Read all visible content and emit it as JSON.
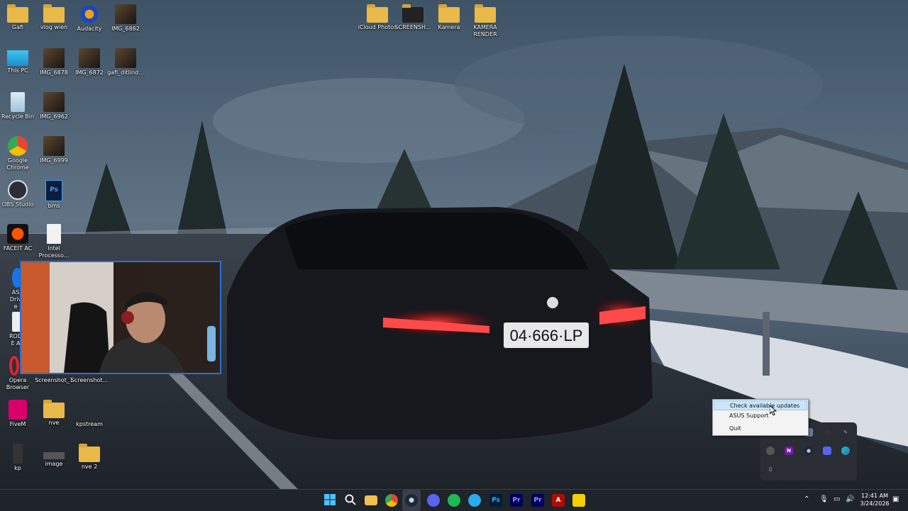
{
  "desktop": {
    "icons": [
      {
        "id": "gafi",
        "label": "Gafi",
        "type": "folder"
      },
      {
        "id": "vlog",
        "label": "vlog wien",
        "type": "folder"
      },
      {
        "id": "audacity",
        "label": "Audacity",
        "type": "app"
      },
      {
        "id": "img6862",
        "label": "IMG_6862",
        "type": "photo"
      },
      {
        "id": "icloud",
        "label": "iCloud Photos",
        "type": "folder"
      },
      {
        "id": "screensh",
        "label": "SCREENSH...",
        "type": "folder"
      },
      {
        "id": "kamera",
        "label": "Kamera",
        "type": "folder"
      },
      {
        "id": "kamerarender",
        "label": "KAMERA RENDER",
        "type": "folder"
      },
      {
        "id": "thispc",
        "label": "This PC",
        "type": "app"
      },
      {
        "id": "img6878",
        "label": "IMG_6878",
        "type": "photo"
      },
      {
        "id": "img6872",
        "label": "IMG_6872",
        "type": "photo"
      },
      {
        "id": "gafidit",
        "label": "gafi_ditlind...",
        "type": "photo"
      },
      {
        "id": "recycle",
        "label": "Recycle Bin",
        "type": "app"
      },
      {
        "id": "img6962",
        "label": "IMG_6962",
        "type": "photo"
      },
      {
        "id": "chrome",
        "label": "Google Chrome",
        "type": "app"
      },
      {
        "id": "img6999",
        "label": "IMG_6999",
        "type": "photo"
      },
      {
        "id": "obs",
        "label": "OBS Studio",
        "type": "app"
      },
      {
        "id": "bms",
        "label": "bms",
        "type": "app"
      },
      {
        "id": "faceit",
        "label": "FACEIT AC",
        "type": "app"
      },
      {
        "id": "intel",
        "label": "Intel Processo...",
        "type": "app"
      },
      {
        "id": "asdrive",
        "label": "AS Drive",
        "type": "app"
      },
      {
        "id": "rode",
        "label": "RODE A",
        "type": "app"
      },
      {
        "id": "opera",
        "label": "Opera Browser",
        "type": "app"
      },
      {
        "id": "shot1",
        "label": "Screenshot_1",
        "type": "app"
      },
      {
        "id": "shot2",
        "label": "Screenshot...",
        "type": "app"
      },
      {
        "id": "fivem",
        "label": "FiveM",
        "type": "app"
      },
      {
        "id": "nve",
        "label": "nve",
        "type": "folder"
      },
      {
        "id": "kpstream",
        "label": "kpstream",
        "type": "app"
      },
      {
        "id": "kp",
        "label": "kp",
        "type": "app"
      },
      {
        "id": "image",
        "label": "image",
        "type": "app"
      },
      {
        "id": "nve2",
        "label": "nve 2",
        "type": "folder"
      }
    ],
    "plate_text": "04·666·LP"
  },
  "context_menu": {
    "items": [
      "Check available updates",
      "ASUS Support",
      "Quit"
    ]
  },
  "tray_flyout": {
    "icons": [
      "unknown-icon",
      "asus-icon",
      "onenote-icon",
      "steam-icon",
      "discord-icon",
      "shield-icon",
      "feather-icon",
      "usb-icon"
    ],
    "onenote_letter": "N"
  },
  "taskbar": {
    "pinned": [
      "windows-start",
      "search",
      "file-explorer",
      "chrome",
      "steam",
      "discord",
      "spotify",
      "telegram",
      "photoshop",
      "premiere-1",
      "premiere-2",
      "adobe-acrobat",
      "sticky-app"
    ],
    "ps_label": "Ps",
    "pr_label": "Pr",
    "time": "12:41 AM",
    "date": "3/24/2026"
  },
  "colors": {
    "taskbar_bg": "#1f232a",
    "accent": "#2b6fd6",
    "menu_highlight": "#cce4f7"
  }
}
